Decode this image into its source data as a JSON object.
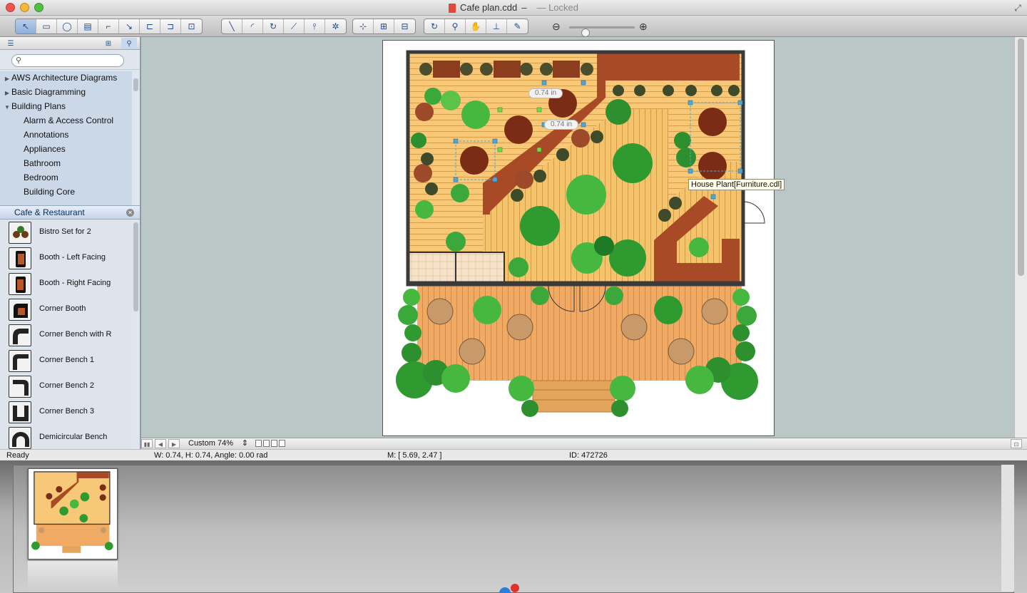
{
  "window": {
    "title": "Cafe plan.cdd",
    "title_dash": "–",
    "lock_status": "— Locked"
  },
  "toolbar": {
    "groups": [
      [
        "pointer-icon",
        "rectangle-icon",
        "ellipse-icon",
        "text-block-icon",
        "connector-icon",
        "smart-connector-icon",
        "tree-connector-icon",
        "clone-connector-icon",
        "insert-icon"
      ],
      [
        "line-icon",
        "arc-icon",
        "bezier-icon",
        "polyline-icon",
        "spline-icon",
        "freehand-icon"
      ],
      [
        "snap-icon",
        "group-icon",
        "align-icon"
      ],
      [
        "rotate-icon",
        "zoom-icon",
        "pan-icon",
        "stamp-icon",
        "eyedropper-icon"
      ]
    ],
    "zoom_out_icon": "zoom-out-icon",
    "zoom_in_icon": "zoom-in-icon",
    "zoom_level": 0.25
  },
  "sidebar": {
    "search_placeholder": "",
    "tree": [
      {
        "label": "AWS Architecture Diagrams",
        "collapsed": true
      },
      {
        "label": "Basic Diagramming",
        "collapsed": true
      },
      {
        "label": "Building Plans",
        "collapsed": false
      },
      {
        "label": "Alarm & Access Control",
        "child": true
      },
      {
        "label": "Annotations",
        "child": true
      },
      {
        "label": "Appliances",
        "child": true
      },
      {
        "label": "Bathroom",
        "child": true
      },
      {
        "label": "Bedroom",
        "child": true
      },
      {
        "label": "Building Core",
        "child": true
      }
    ],
    "library_title": "Cafe & Restaurant",
    "library_items": [
      "Bistro Set for 2",
      "Booth - Left Facing",
      "Booth - Right Facing",
      "Corner Booth",
      "Corner Bench with R",
      "Corner Bench 1",
      "Corner Bench 2",
      "Corner Bench 3",
      "Demicircular Bench"
    ]
  },
  "canvas": {
    "dim_label_1": "0.74 in",
    "dim_label_2": "0.74 in",
    "tooltip": "House Plant[Furniture.cdl]"
  },
  "bottombar": {
    "zoom_select": "Custom 74%"
  },
  "status": {
    "ready": "Ready",
    "dims": "W: 0.74,  H: 0.74,  Angle: 0.00 rad",
    "mouse": "M: [ 5.69, 2.47 ]",
    "id": "ID: 472726"
  },
  "colors": {
    "floor": "#f6c878",
    "wall": "#3a3a3a",
    "table": "#8b3d1e",
    "plant": "#3aa83a",
    "bar": "#a84a25",
    "canvas_bg": "#b9c7c7"
  }
}
